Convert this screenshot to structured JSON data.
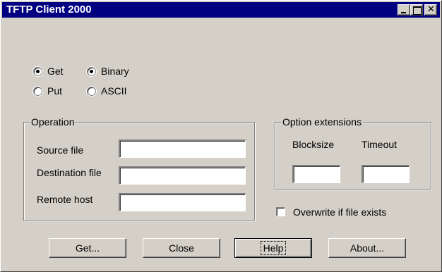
{
  "window": {
    "title": "TFTP Client 2000"
  },
  "mode": {
    "get_label": "Get",
    "put_label": "Put",
    "selected": "Get"
  },
  "transfer": {
    "binary_label": "Binary",
    "ascii_label": "ASCII",
    "selected": "Binary"
  },
  "operation": {
    "legend": "Operation",
    "source_label": "Source file",
    "destination_label": "Destination file",
    "remote_label": "Remote host",
    "source_value": "",
    "destination_value": "",
    "remote_value": ""
  },
  "options": {
    "legend": "Option extensions",
    "blocksize_label": "Blocksize",
    "timeout_label": "Timeout",
    "blocksize_value": "",
    "timeout_value": ""
  },
  "overwrite": {
    "label": "Overwrite if file exists",
    "checked": false
  },
  "buttons": {
    "get": "Get...",
    "close": "Close",
    "help": "Help",
    "about": "About..."
  },
  "icons": {
    "minimize": "minimize-icon",
    "maximize": "maximize-icon",
    "close": "close-icon"
  },
  "colors": {
    "titlebar": "#000080",
    "face": "#d4d0c8"
  }
}
